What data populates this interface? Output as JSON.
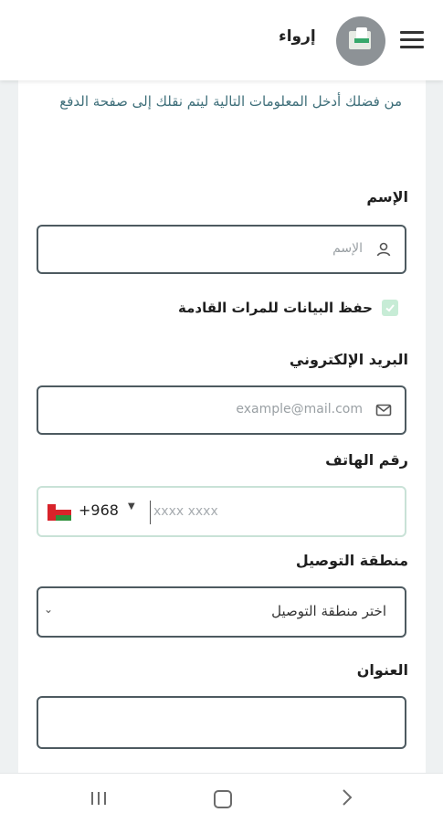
{
  "header": {
    "brand": "إرواء",
    "menu_icon": "hamburger-menu-icon",
    "avatar_icon": "store-avatar"
  },
  "form": {
    "intro": "من فضلك أدخل المعلومات التالية ليتم نقلك إلى صفحة الدفع",
    "name_label": "الإسم",
    "name_placeholder": "الإسم",
    "save_label": "حفظ البيانات للمرات القادمة",
    "save_checked": true,
    "email_label": "البريد الإلكتروني",
    "email_placeholder": "example@mail.com",
    "phone_label": "رقم الهاتف",
    "dial_code": "+968",
    "phone_placeholder": "xxxx xxxx",
    "region_label": "منطقة التوصيل",
    "region_selected": "اختر منطقة التوصيل",
    "address_label": "العنوان",
    "address_value": ""
  },
  "colors": {
    "accent": "#3f6f7a",
    "checkbox": "#c7ecd6",
    "border": "#4d5a60"
  }
}
